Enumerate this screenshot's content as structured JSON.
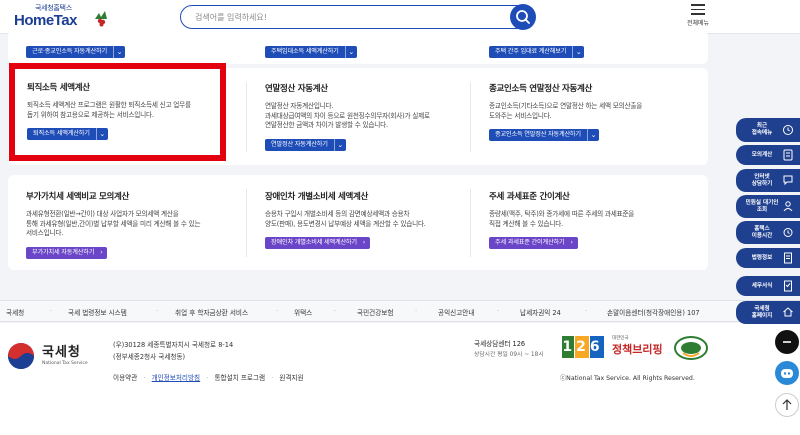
{
  "header": {
    "logo_sub": "국세청홈택스",
    "logo_main": "HomeTax",
    "search_placeholder": "검색어를 입력하세요!",
    "menu_label": "전체메뉴"
  },
  "top_row": {
    "buttons": [
      "근로·종교인소득 자동계산하기",
      "주택임대소득 세액계산하기",
      "주택 간주 임대료 계산해보기"
    ]
  },
  "services_row1": [
    {
      "title": "퇴직소득 세액계산",
      "desc": [
        "퇴직소득 세액계산 프로그램은 원활한 퇴직소득세 신고 업무를",
        "돕기 위하여 참고용으로 제공하는 서비스입니다."
      ],
      "button": "퇴직소득 세액계산하기"
    },
    {
      "title": "연말정산 자동계산",
      "desc": [
        "연말정산 자동계산입니다.",
        "과세대상급여액의 차이 등으로 원천징수의무자(회사)가 실제로",
        "연말정산한 금액과 차이가 발생할 수 있습니다."
      ],
      "button": "연말정산 자동계산하기"
    },
    {
      "title": "종교인소득 연말정산 자동계산",
      "desc": [
        "종교인소득(기타소득)으로 연말정산 하는 세액 모의산출을",
        "도와주는 서비스입니다."
      ],
      "button": "종교인소득 연말정산 자동계산하기"
    }
  ],
  "services_row2": [
    {
      "title": "부가가치세 세액비교 모의계산",
      "desc": [
        "과세유형전환(일반→간이) 대상 사업자가 모의세액 계산을",
        "통해 과세유형(일반,간이)별 납부할 세액을 미리 계산해 볼 수 있는",
        "서비스입니다."
      ],
      "button": "부가가치세 자동계산하기"
    },
    {
      "title": "장애인차 개별소비세 세액계산",
      "desc": [
        "승용차 구입시 개별소비세 등의 감면예상세액과 승용차",
        "양도(판매), 용도변경시 납부예상 세액을 계산할 수 있습니다."
      ],
      "button": "장애인차 개별소비세 세액계산하기"
    },
    {
      "title": "주세 과세표준 간이계산",
      "desc": [
        "종량세(맥주, 탁주)와 종가세에 따른 주세의 과세표준을",
        "직접 계산해 볼 수 있습니다."
      ],
      "button": "주세 과세표준 간이계산하기"
    }
  ],
  "footer_links": [
    "국세청",
    "국세 법령정보 시스템",
    "취업 후 학자금상환 서비스",
    "위택스",
    "국민건강보험",
    "공익신고안내",
    "납세자권익 24",
    "손말이음센터(청각장애인용) 107"
  ],
  "footer": {
    "org_name": "국세청",
    "org_eng": "National Tax Service",
    "address1": "(우)30128 세종특별자치시 국세청로 8-14",
    "address2": "(정부세종2청사 국세청동)",
    "bottom_links": [
      "이용약관",
      "개인정보처리방침",
      "통합설치 프로그램",
      "원격지원"
    ],
    "call_center": "국세상담센터 126",
    "hours": "상담시간 평일 09시 ~ 18시",
    "num_126": "126",
    "brand_top": "대한민국",
    "brand_main": "정책브리핑",
    "copyright": "ⓒNational Tax Service. All Rights Reserved."
  },
  "quick_menu": [
    {
      "label1": "최근",
      "label2": "접속메뉴"
    },
    {
      "label1": "모의계산",
      "label2": ""
    },
    {
      "label1": "인터넷",
      "label2": "상담하기"
    },
    {
      "label1": "민원실 대기인",
      "label2": "조회"
    },
    {
      "label1": "홈택스",
      "label2": "이용시간"
    },
    {
      "label1": "법령정보",
      "label2": ""
    },
    {
      "label1": "세무서식",
      "label2": ""
    },
    {
      "label1": "국세청",
      "label2": "홈페이지"
    }
  ]
}
